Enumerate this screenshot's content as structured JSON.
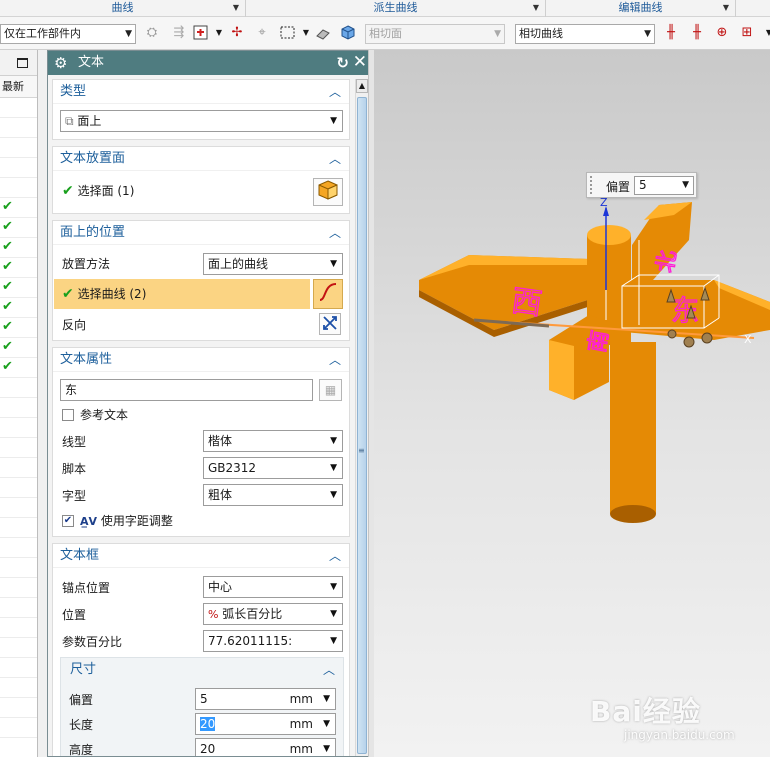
{
  "ribbon": {
    "groups": [
      {
        "label": "曲线"
      },
      {
        "label": "派生曲线"
      },
      {
        "label": "编辑曲线"
      }
    ],
    "scope_combo": "仅在工作部件内",
    "tangent_face_combo": "相切面",
    "tangent_curve_combo": "相切曲线"
  },
  "nav": {
    "column_header": "最新",
    "rows": [
      false,
      false,
      false,
      false,
      false,
      true,
      true,
      true,
      true,
      true,
      true,
      true,
      true,
      true,
      false,
      false,
      false,
      false,
      false,
      false,
      false,
      false,
      false,
      false,
      false,
      false,
      false,
      false,
      false,
      false,
      false,
      false
    ]
  },
  "dialog": {
    "title": "文本",
    "sections": {
      "type": {
        "title": "类型",
        "value": "面上"
      },
      "placement_face": {
        "title": "文本放置面",
        "select_label": "选择面 (1)"
      },
      "position_on_face": {
        "title": "面上的位置",
        "method_label": "放置方法",
        "method_value": "面上的曲线",
        "select_curve_label": "选择曲线 (2)",
        "reverse_label": "反向"
      },
      "text_props": {
        "title": "文本属性",
        "text_value": "东",
        "reference_text_label": "参考文本",
        "reference_text_checked": false,
        "line_type_label": "线型",
        "line_type_value": "楷体",
        "script_label": "脚本",
        "script_value": "GB2312",
        "style_label": "字型",
        "style_value": "粗体",
        "kerning_label": "使用字距调整",
        "kerning_checked": true
      },
      "text_box": {
        "title": "文本框",
        "anchor_label": "锚点位置",
        "anchor_value": "中心",
        "position_label": "位置",
        "position_value": "弧长百分比",
        "param_percent_label": "参数百分比",
        "param_percent_value": "77.62011115:"
      },
      "dimensions": {
        "title": "尺寸",
        "offset_label": "偏置",
        "offset_value": "5",
        "offset_unit": "mm",
        "length_label": "长度",
        "length_value": "20",
        "length_unit": "mm",
        "height_label": "高度",
        "height_value": "20",
        "height_unit": "mm"
      }
    }
  },
  "viewport": {
    "offset_label": "偏置",
    "offset_value": "5",
    "axis_z": "Z",
    "axis_x": "X",
    "text_west": "西",
    "text_east": "东",
    "text_north": "北",
    "text_south": "南",
    "colors": {
      "body": "#e58a05",
      "body_dark": "#a95f00",
      "body_light": "#ffb12a",
      "text_magenta": "#ff1dd8"
    }
  },
  "watermark": {
    "brand": "Bai经验",
    "url": "jingyan.baidu.com"
  }
}
